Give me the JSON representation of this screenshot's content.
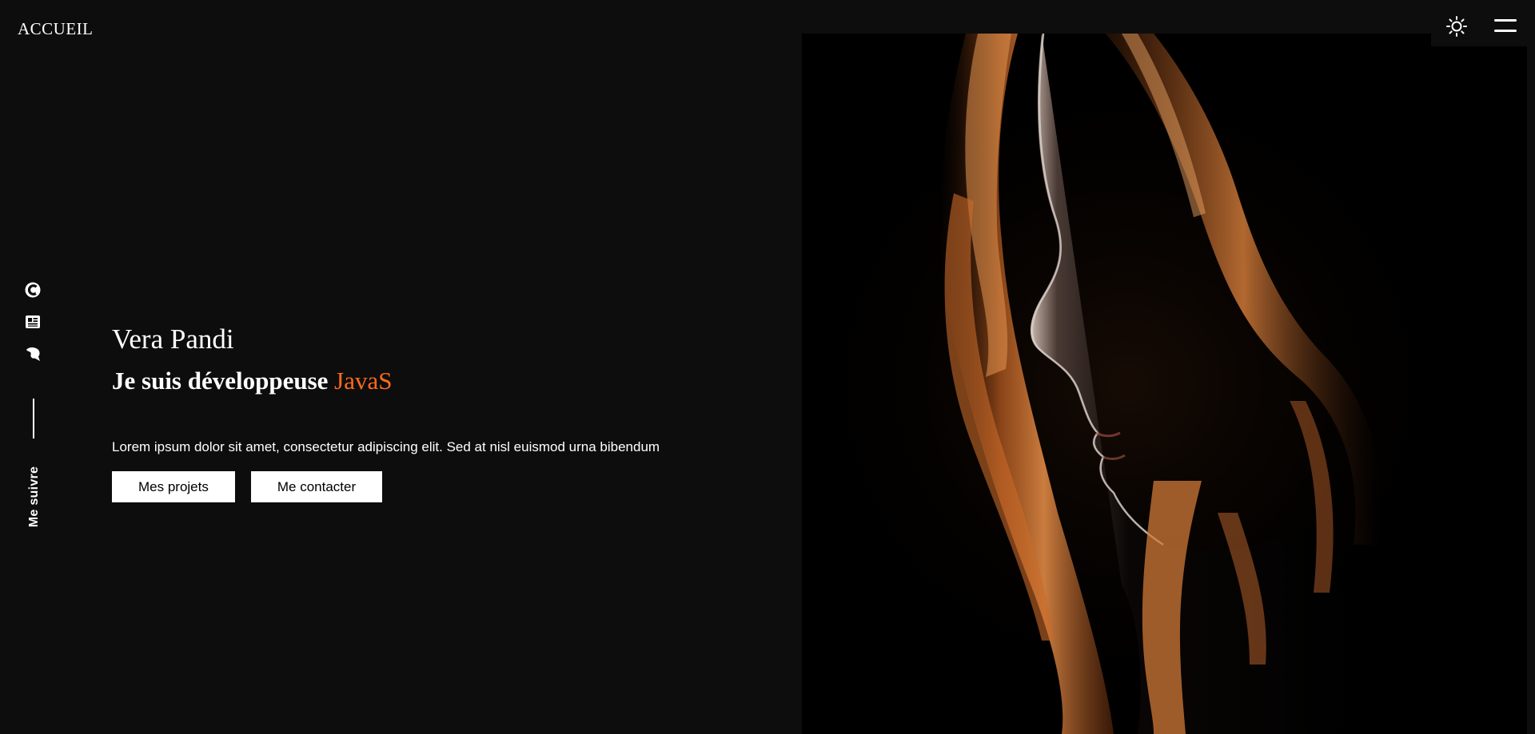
{
  "header": {
    "brand": "ACCUEIL",
    "theme_toggle_icon": "sun-icon",
    "menu_icon": "hamburger-menu-icon"
  },
  "social": {
    "icons": [
      "codepen-icon",
      "linkedin-icon",
      "codersrank-icon"
    ],
    "follow_label": "Me suivre"
  },
  "hero": {
    "name": "Vera Pandi",
    "role_prefix": "Je suis développeuse ",
    "role_highlight": "JavaS",
    "description": "Lorem ipsum dolor sit amet, consectetur adipiscing elit. Sed at nisl euismod urna bibendum",
    "buttons": {
      "projects": "Mes projets",
      "contact": "Me contacter"
    }
  },
  "photo": {
    "subject": "portrait-photo"
  },
  "colors": {
    "background": "#0d0d0d",
    "text": "#ffffff",
    "accent": "#ff6a1a",
    "button_bg": "#ffffff",
    "button_text": "#000000"
  }
}
